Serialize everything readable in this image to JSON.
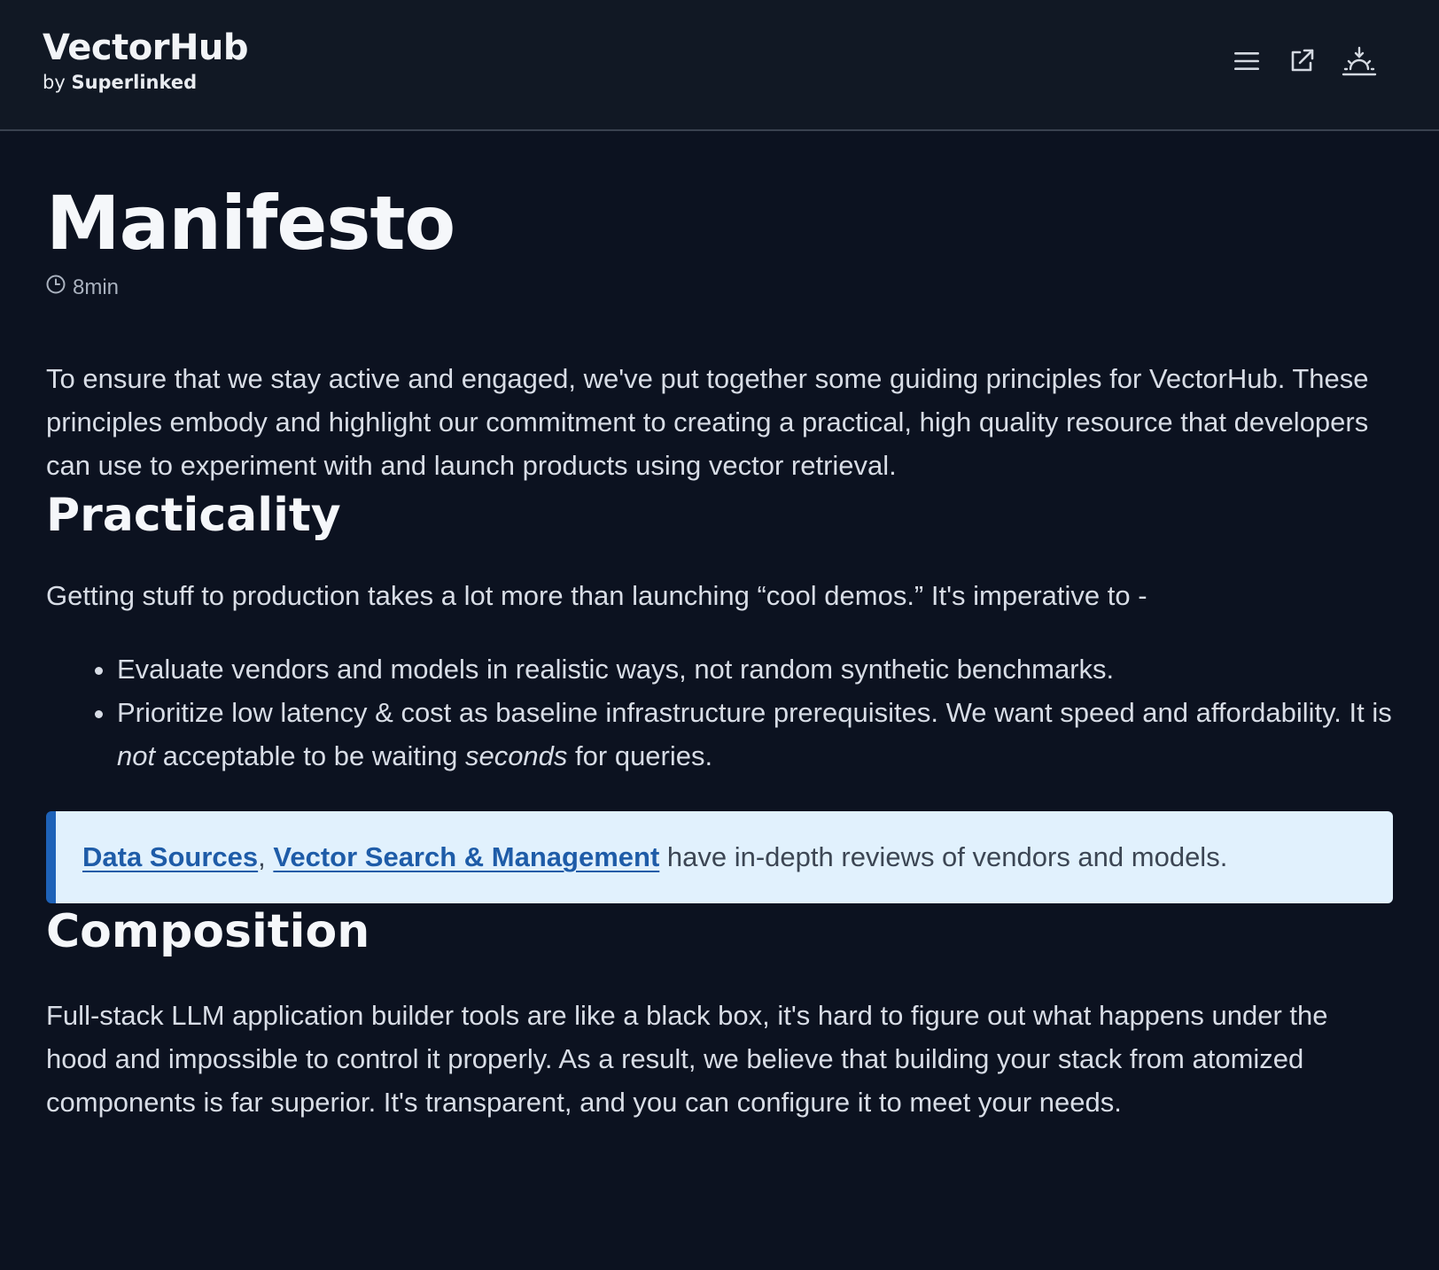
{
  "header": {
    "logo_title": "VectorHub",
    "logo_by": "by",
    "logo_brand": "Superlinked",
    "icons": [
      "menu-icon",
      "external-link-icon",
      "theme-toggle-icon"
    ]
  },
  "article": {
    "title": "Manifesto",
    "read_time": "8min",
    "intro": "To ensure that we stay active and engaged, we've put together some guiding principles for VectorHub. These principles embody and highlight our commitment to creating a practical, high quality resource that developers can use to experiment with and launch products using vector retrieval.",
    "sections": [
      {
        "heading": "Practicality",
        "paragraph": "Getting stuff to production takes a lot more than launching “cool demos.” It's imperative to -",
        "bullets": [
          {
            "text": "Evaluate vendors and models in realistic ways, not random synthetic benchmarks."
          },
          {
            "part1": "Prioritize low latency & cost as baseline infrastructure prerequisites. We want speed and affordability. It is ",
            "em1": "not",
            "part2": " acceptable to be waiting ",
            "em2": "seconds",
            "part3": " for queries."
          }
        ],
        "callout": {
          "link1": "Data Sources",
          "separator": ",",
          "link2": "Vector Search & Management",
          "text": " have in-depth reviews of vendors and models."
        }
      },
      {
        "heading": "Composition",
        "paragraph": "Full-stack LLM application builder tools are like a black box, it's hard to figure out what happens under the hood and impossible to control it properly. As a result, we believe that building your stack from atomized components is far superior. It's transparent, and you can configure it to meet your needs."
      }
    ]
  },
  "colors": {
    "background": "#0c1220",
    "header_bg": "#111824",
    "callout_bg": "#e1f1fd",
    "callout_border": "#1e62b8",
    "link": "#1e5ca8"
  }
}
